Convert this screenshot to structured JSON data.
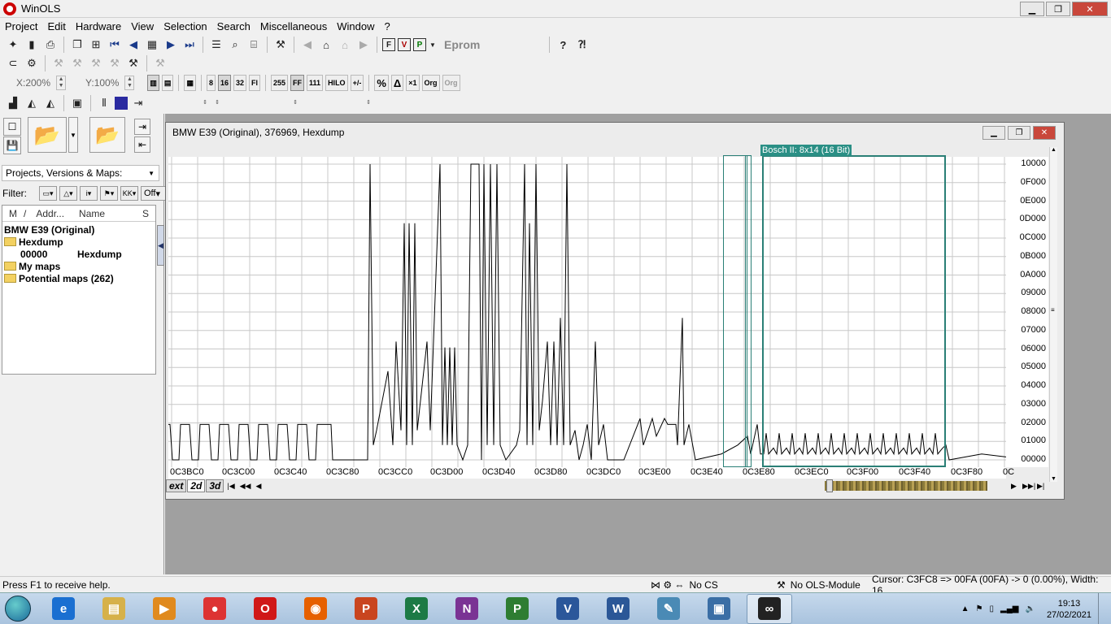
{
  "window": {
    "title": "WinOLS"
  },
  "menu": [
    "Project",
    "Edit",
    "Hardware",
    "View",
    "Selection",
    "Search",
    "Miscellaneous",
    "Window",
    "?"
  ],
  "toolbar": {
    "eprom_label": "Eprom",
    "zoom_x": "X:200%",
    "zoom_y": "Y:100%",
    "bits_8": "8",
    "bits_16": "16",
    "bits_32": "32",
    "fl": "Fl",
    "val_255": "255",
    "val_ff": "FF",
    "val_111": "111",
    "hilo": "HILO",
    "percent": "%",
    "delta": "Δ",
    "x1": "×1",
    "org": "Org",
    "org2": "Org"
  },
  "left_panel": {
    "dropdown": "Projects, Versions & Maps:",
    "filter_label": "Filter:",
    "filter_off": "Off",
    "columns": [
      "M",
      "/",
      "Addr...",
      "Name",
      "S"
    ],
    "tree": [
      {
        "label": "BMW E39 (Original)",
        "indent": 0,
        "folder": false
      },
      {
        "label": "Hexdump",
        "indent": 0,
        "folder": true
      },
      {
        "label": "00000",
        "name": "Hexdump",
        "indent": 1,
        "folder": false
      },
      {
        "label": "My maps",
        "indent": 0,
        "folder": true
      },
      {
        "label": "Potential maps (262)",
        "indent": 0,
        "folder": true
      }
    ]
  },
  "child_window": {
    "title": "BMW E39 (Original), 376969, Hexdump",
    "map_label": "Bosch II: 8x14 (16 Bit)",
    "tabs": [
      "ext",
      "2d",
      "3d"
    ]
  },
  "chart_data": {
    "type": "line",
    "x_labels": [
      "0C3BC0",
      "0C3C00",
      "0C3C40",
      "0C3C80",
      "0C3CC0",
      "0C3D00",
      "0C3D40",
      "0C3D80",
      "0C3DC0",
      "0C3E00",
      "0C3E40",
      "0C3E80",
      "0C3EC0",
      "0C3F00",
      "0C3F40",
      "0C3F80",
      "0C"
    ],
    "y_labels": [
      "10000",
      "0F000",
      "0E000",
      "0D000",
      "0C000",
      "0B000",
      "0A000",
      "09000",
      "08000",
      "07000",
      "06000",
      "05000",
      "04000",
      "03000",
      "02000",
      "01000",
      "00000"
    ],
    "ylim": [
      0,
      65536
    ],
    "grid": true
  },
  "status": {
    "help": "Press F1 to receive help.",
    "cs": "No CS",
    "module": "No OLS-Module",
    "cursor": "Cursor: C3FC8 => 00FA (00FA) -> 0 (0.00%), Width: 16"
  },
  "taskbar": {
    "apps": [
      {
        "name": "ie",
        "glyph": "e",
        "color": "#1a6fd1"
      },
      {
        "name": "explorer",
        "glyph": "▤",
        "color": "#d6b14a"
      },
      {
        "name": "media",
        "glyph": "▶",
        "color": "#e08a1e"
      },
      {
        "name": "chrome",
        "glyph": "●",
        "color": "#d33"
      },
      {
        "name": "opera",
        "glyph": "O",
        "color": "#d01818"
      },
      {
        "name": "firefox",
        "glyph": "◉",
        "color": "#e66000"
      },
      {
        "name": "powerpoint",
        "glyph": "P",
        "color": "#c9451f"
      },
      {
        "name": "excel",
        "glyph": "X",
        "color": "#1d7a45"
      },
      {
        "name": "onenote",
        "glyph": "N",
        "color": "#7a3394"
      },
      {
        "name": "project",
        "glyph": "P",
        "color": "#2e7d32"
      },
      {
        "name": "visio",
        "glyph": "V",
        "color": "#2b579a"
      },
      {
        "name": "word",
        "glyph": "W",
        "color": "#2b5797"
      },
      {
        "name": "paint",
        "glyph": "✎",
        "color": "#4a8ab5"
      },
      {
        "name": "remote",
        "glyph": "▣",
        "color": "#3a6ea5"
      },
      {
        "name": "winols",
        "glyph": "∞",
        "color": "#222"
      }
    ],
    "time": "19:13",
    "date": "27/02/2021"
  }
}
